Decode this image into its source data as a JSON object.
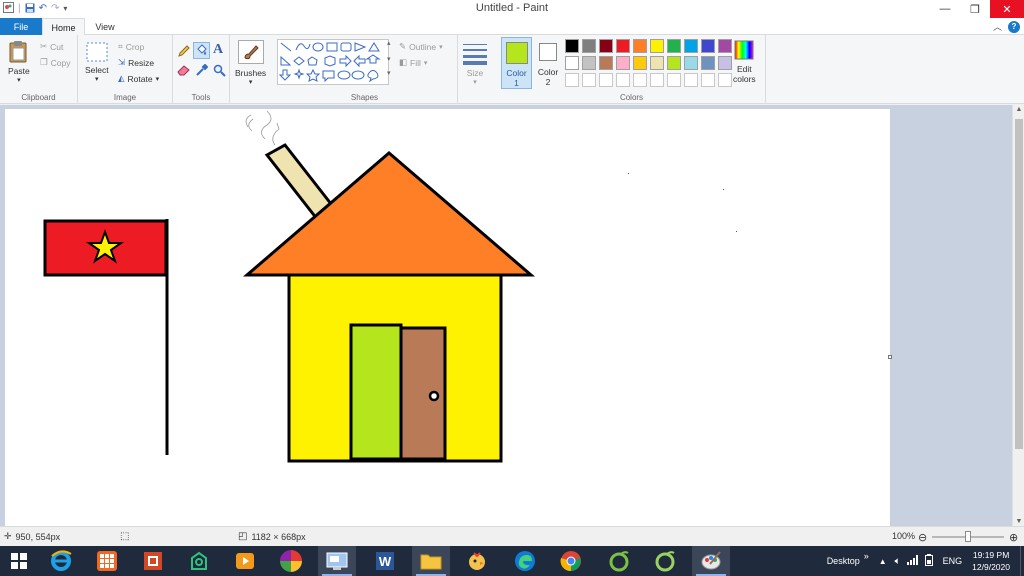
{
  "window": {
    "title": "Untitled - Paint",
    "controls": {
      "minimize": "—",
      "maximize": "❐",
      "close": "✕"
    }
  },
  "tabs": {
    "file": "File",
    "home": "Home",
    "view": "View"
  },
  "ribbon": {
    "clipboard": {
      "label": "Clipboard",
      "paste": "Paste",
      "cut": "Cut",
      "copy": "Copy"
    },
    "image": {
      "label": "Image",
      "select": "Select",
      "crop": "Crop",
      "resize": "Resize",
      "rotate": "Rotate"
    },
    "tools": {
      "label": "Tools"
    },
    "brushes": {
      "label": "Brushes"
    },
    "shapes": {
      "label": "Shapes",
      "outline": "Outline",
      "fill": "Fill"
    },
    "size": {
      "label": "Size"
    },
    "colors": {
      "label": "Colors",
      "color1_label": "Color",
      "color1_num": "1",
      "color2_label": "Color",
      "color2_num": "2",
      "color1_value": "#b5e61d",
      "color2_value": "#ffffff",
      "edit_line1": "Edit",
      "edit_line2": "colors",
      "palette_row1": [
        "#000000",
        "#7f7f7f",
        "#880015",
        "#ed1c24",
        "#ff7f27",
        "#fff200",
        "#22b14c",
        "#00a2e8",
        "#3f48cc",
        "#a349a4"
      ],
      "palette_row2": [
        "#ffffff",
        "#c3c3c3",
        "#b97a57",
        "#ffaec9",
        "#ffc90e",
        "#efe4b0",
        "#b5e61d",
        "#99d9ea",
        "#7092be",
        "#c8bfe7"
      ]
    }
  },
  "drawing": {
    "flag_red": "#ed1c24",
    "star_yellow": "#fff200",
    "roof_orange": "#ff7f27",
    "wall_yellow": "#fff200",
    "door_green": "#b5e61d",
    "door_brown": "#b97a57",
    "chimney": "#efe4b0"
  },
  "status": {
    "cursor_pos": "950, 554px",
    "canvas_size": "1182 × 668px",
    "zoom": "100%"
  },
  "taskbar": {
    "desktop": "Desktop",
    "lang": "ENG",
    "time": "19:19 PM",
    "date": "12/9/2020"
  }
}
